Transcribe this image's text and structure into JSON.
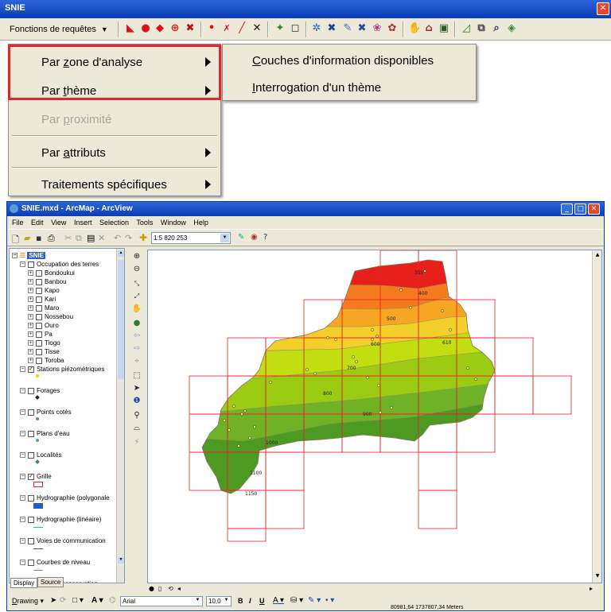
{
  "snie_window": {
    "title": "SNIE"
  },
  "toolbar": {
    "fonctions_label": "Fonctions de requêtes"
  },
  "menu": {
    "items": [
      {
        "label": "Par zone d'analyse",
        "accel": "z",
        "submenu": true,
        "enabled": true
      },
      {
        "label": "Par thème",
        "accel": "t",
        "submenu": true,
        "enabled": true
      },
      {
        "label": "Par proximité",
        "accel": "p",
        "submenu": false,
        "enabled": false
      },
      {
        "label": "Par attributs",
        "accel": "a",
        "submenu": true,
        "enabled": true
      },
      {
        "label": "Traitements spécifiques",
        "accel": "",
        "submenu": true,
        "enabled": true
      }
    ]
  },
  "submenu": {
    "items": [
      {
        "label": "Couches d'information disponibles"
      },
      {
        "label": "Interrogation d'un thème"
      }
    ]
  },
  "arcmap": {
    "title": "SNIE.mxd - ArcMap - ArcView",
    "menus": [
      "File",
      "Edit",
      "View",
      "Insert",
      "Selection",
      "Tools",
      "Window",
      "Help"
    ],
    "scale": "1:5 820 253",
    "coords": "80981,64  1737807,34 Meters"
  },
  "toc": {
    "root": "SNIE",
    "group": "Occupation des terres",
    "sublayers": [
      "Bondoukui",
      "Banbou",
      "Kapo",
      "Kari",
      "Maro",
      "Nossebou",
      "Ouro",
      "Pa",
      "Tiogo",
      "Tisse",
      "Toroba"
    ],
    "layers": [
      {
        "name": "Stations piézométriques",
        "checked": true
      },
      {
        "name": "Forages",
        "checked": false
      },
      {
        "name": "Points cotés",
        "checked": false
      },
      {
        "name": "Plans d'eau",
        "checked": false
      },
      {
        "name": "Localités",
        "checked": false
      },
      {
        "name": "Grille",
        "checked": true
      },
      {
        "name": "Hydrographie (polygonale",
        "checked": false
      },
      {
        "name": "Hydrographie (linéaire)",
        "checked": false
      },
      {
        "name": "Voies de communication",
        "checked": false
      },
      {
        "name": "Courbes de niveau",
        "checked": false
      },
      {
        "name": "Aires de conservation",
        "checked": false
      }
    ],
    "tabs": [
      "Display",
      "Source"
    ]
  },
  "draw_toolbar": {
    "drawing_label": "Drawing",
    "font": "Arial",
    "size": "10,0",
    "bold": "B",
    "italic": "I",
    "underline": "U"
  },
  "map": {
    "contour_labels": [
      "350",
      "400",
      "500",
      "600",
      "610",
      "700",
      "800",
      "900",
      "1000",
      "1100",
      "1150"
    ],
    "colors": {
      "red": "#e8201b",
      "orange": "#f47a1d",
      "amber": "#f5a623",
      "yellow": "#f2cf2a",
      "lime": "#c2dd10",
      "green_light": "#9ccb14",
      "green": "#6fb226",
      "green_dark": "#4d9a23",
      "grid": "#e3262b"
    }
  }
}
